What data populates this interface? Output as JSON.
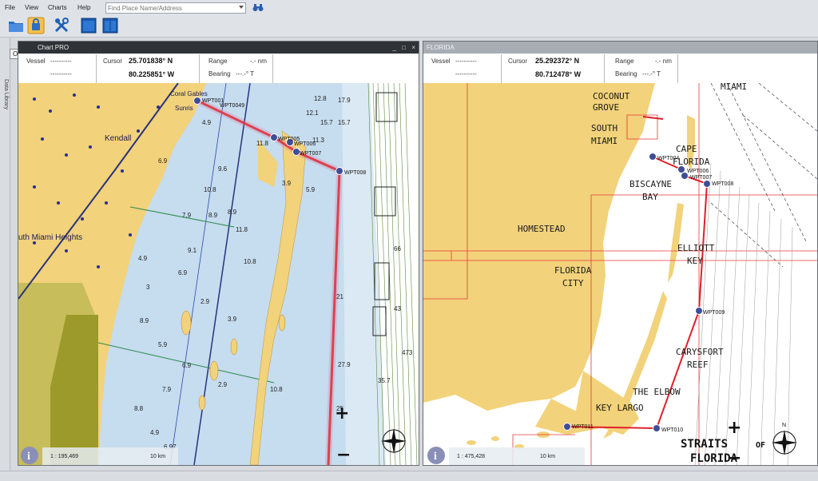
{
  "menu": {
    "file": "File",
    "view": "View",
    "charts": "Charts",
    "help": "Help"
  },
  "search": {
    "placeholder": "Find Place Name/Address"
  },
  "toolbar": {
    "tooltip": "Open Chart"
  },
  "sidebar": {
    "label": "Data Library"
  },
  "left_panel": {
    "title": "Chart PRO",
    "vessel_label": "Vessel",
    "vessel_lat": "----------",
    "vessel_lon": "----------",
    "cursor_label": "Cursor",
    "cursor_lat": "25.701838° N",
    "cursor_lon": "80.225851° W",
    "range_label": "Range",
    "range_val": "-.- nm",
    "bearing_label": "Bearing",
    "bearing_val": "---.-° T",
    "scale": "1 : 195,469",
    "scale_bar": "10 km",
    "labels": {
      "kendall": "Kendall",
      "south_miami_heights": "uth Miami Heights",
      "coral_gables": "Coral Gables",
      "sunrise": "Sunris"
    },
    "waypoints": [
      "WPT001",
      "WPT0049",
      "WPT005",
      "WPT006",
      "WPT007",
      "WPT008"
    ],
    "depths": [
      "12.8",
      "17.9",
      "12.1",
      "15.7",
      "15.7",
      "11.3",
      "11.8",
      "9.6",
      "10.8",
      "8.9",
      "7.9",
      "6.9",
      "3.9",
      "5.9",
      "10.8",
      "9.1",
      "6.9",
      "2.9",
      "4.9",
      "8.9",
      "11.8",
      "3",
      "5.9",
      "6.9",
      "7.9",
      "8.9",
      "3.9",
      "2.9",
      "4.9",
      "8.8",
      "10.8",
      "6.97",
      "21",
      "25",
      "27.9",
      "43",
      "66",
      "35.7",
      "473",
      "4.9"
    ]
  },
  "right_panel": {
    "title": "FLORIDA",
    "vessel_label": "Vessel",
    "vessel_lat": "----------",
    "vessel_lon": "----------",
    "cursor_label": "Cursor",
    "cursor_lat": "25.292372° N",
    "cursor_lon": "80.712478° W",
    "range_label": "Range",
    "range_val": "-.- nm",
    "bearing_label": "Bearing",
    "bearing_val": "---.-° T",
    "scale": "1 : 475,428",
    "scale_bar": "10 km",
    "labels": {
      "miami": "MIAMI",
      "coconut_grove_1": "COCONUT",
      "coconut_grove_2": "GROVE",
      "south_miami_1": "SOUTH",
      "south_miami_2": "MIAMI",
      "cape_florida_1": "CAPE",
      "cape_florida_2": "FLORIDA",
      "biscayne_1": "BISCAYNE",
      "biscayne_2": "BAY",
      "homestead": "HOMESTEAD",
      "elliott_1": "ELLIOTT",
      "elliott_2": "KEY",
      "florida_city_1": "FLORIDA",
      "florida_city_2": "CITY",
      "carysfort_1": "CARYSFORT",
      "carysfort_2": "REEF",
      "elbow": "THE ELBOW",
      "key_largo": "KEY LARGO",
      "straits_1": "STRAITS",
      "straits_2": "FLORIDA",
      "straits_of": "OF"
    },
    "waypoints": [
      "WPT004",
      "WPT006",
      "WPT007",
      "WPT008",
      "WPT009",
      "WPT010",
      "WPT011"
    ]
  },
  "colors": {
    "land": "#f2d27a",
    "water": "#c6dcef",
    "deep": "#ffffff",
    "route": "#e0202a",
    "chartline": "#e43a3a",
    "wpt": "#3e4e96"
  }
}
